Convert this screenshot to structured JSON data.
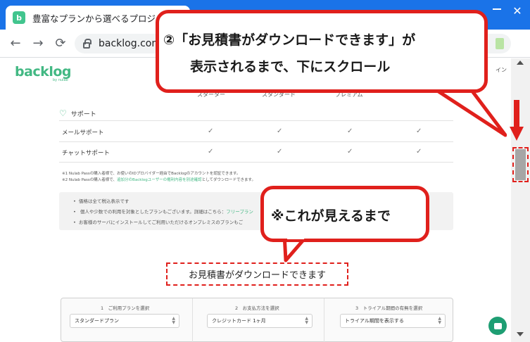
{
  "browser": {
    "tab_title": "豊富なプランから選べるプロジェクト管",
    "favicon_letter": "b",
    "url": "backlog.com/",
    "close_glyph": "✕"
  },
  "header": {
    "logo": "backlog",
    "logo_sub": "by nulab",
    "right_link": "イン"
  },
  "plans": {
    "columns": [
      "スターター",
      "スタンダード",
      "プレミアム"
    ]
  },
  "support": {
    "section_label": "サポート",
    "rows": [
      {
        "label": "メールサポート"
      },
      {
        "label": "チャットサポート"
      }
    ],
    "check_glyph": "✓"
  },
  "notes": {
    "line1": "※1 Nulab Passの購入者様で、お使いのIDプロバイダー経由でBacklogのアカウントを認証できます。",
    "line2_prefix": "※2 Nulab Passの購入者様で、",
    "line2_highlight": "追加分のBacklogユーザーの権利内容を別途確認",
    "line2_suffix": "としてダウンロードできます。"
  },
  "info": {
    "line1": "価格は全て税込表示です",
    "line2_prefix": "個人や少数での利用を対象としたプランもございます。詳細はこちら：",
    "line2_link": "フリープラン",
    "line3": "お客様のサーバにインストールしてご利用いただけるオンプレミスのプランもご"
  },
  "estimate": {
    "title": "お見積書がダウンロードできます"
  },
  "steps": [
    {
      "label": "1　ご利用プランを選択",
      "value": "スタンダードプラン"
    },
    {
      "label": "2　お支払方法を選択",
      "value": "クレジットカード 1ヶ月"
    },
    {
      "label": "3　トライアル期間の有無を選択",
      "value": "トライアル期間を表示する"
    }
  ],
  "annotations": {
    "callout1_line1": "②「お見積書がダウンロードできます」が",
    "callout1_line2": "表示されるまで、下にスクロール",
    "callout2": "※これが見えるまで"
  },
  "colors": {
    "accent": "#42b883",
    "annotation_red": "#e0201c",
    "chrome_blue": "#1a73e8"
  }
}
